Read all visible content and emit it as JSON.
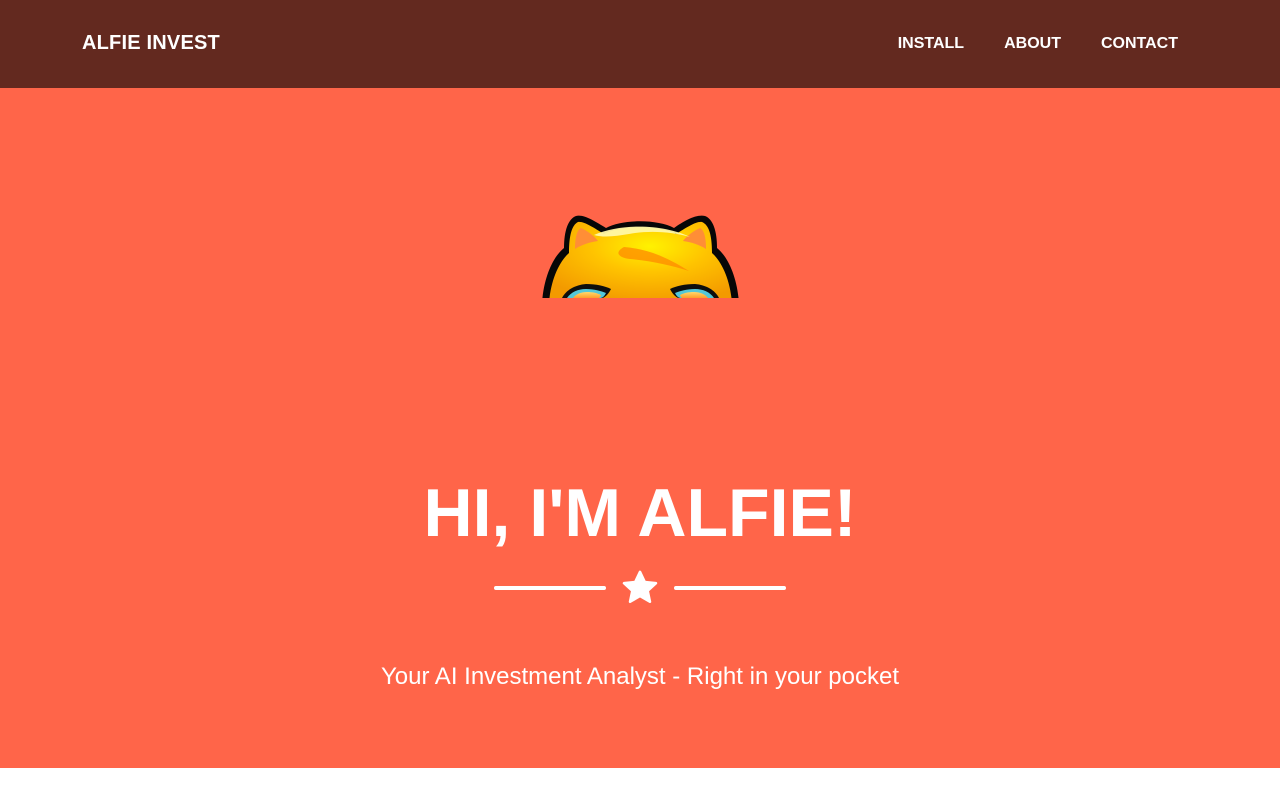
{
  "navbar": {
    "brand": "ALFIE INVEST",
    "links": [
      {
        "label": "INSTALL"
      },
      {
        "label": "ABOUT"
      },
      {
        "label": "CONTACT"
      }
    ]
  },
  "hero": {
    "headline": "HI, I'M ALFIE!",
    "divider_icon": "star-icon",
    "subtitle": "Your AI Investment Analyst - Right in your pocket"
  },
  "colors": {
    "navbar_bg": "#63291f",
    "hero_bg": "#ff6549",
    "text": "#ffffff",
    "page_bg": "#ffffff"
  }
}
